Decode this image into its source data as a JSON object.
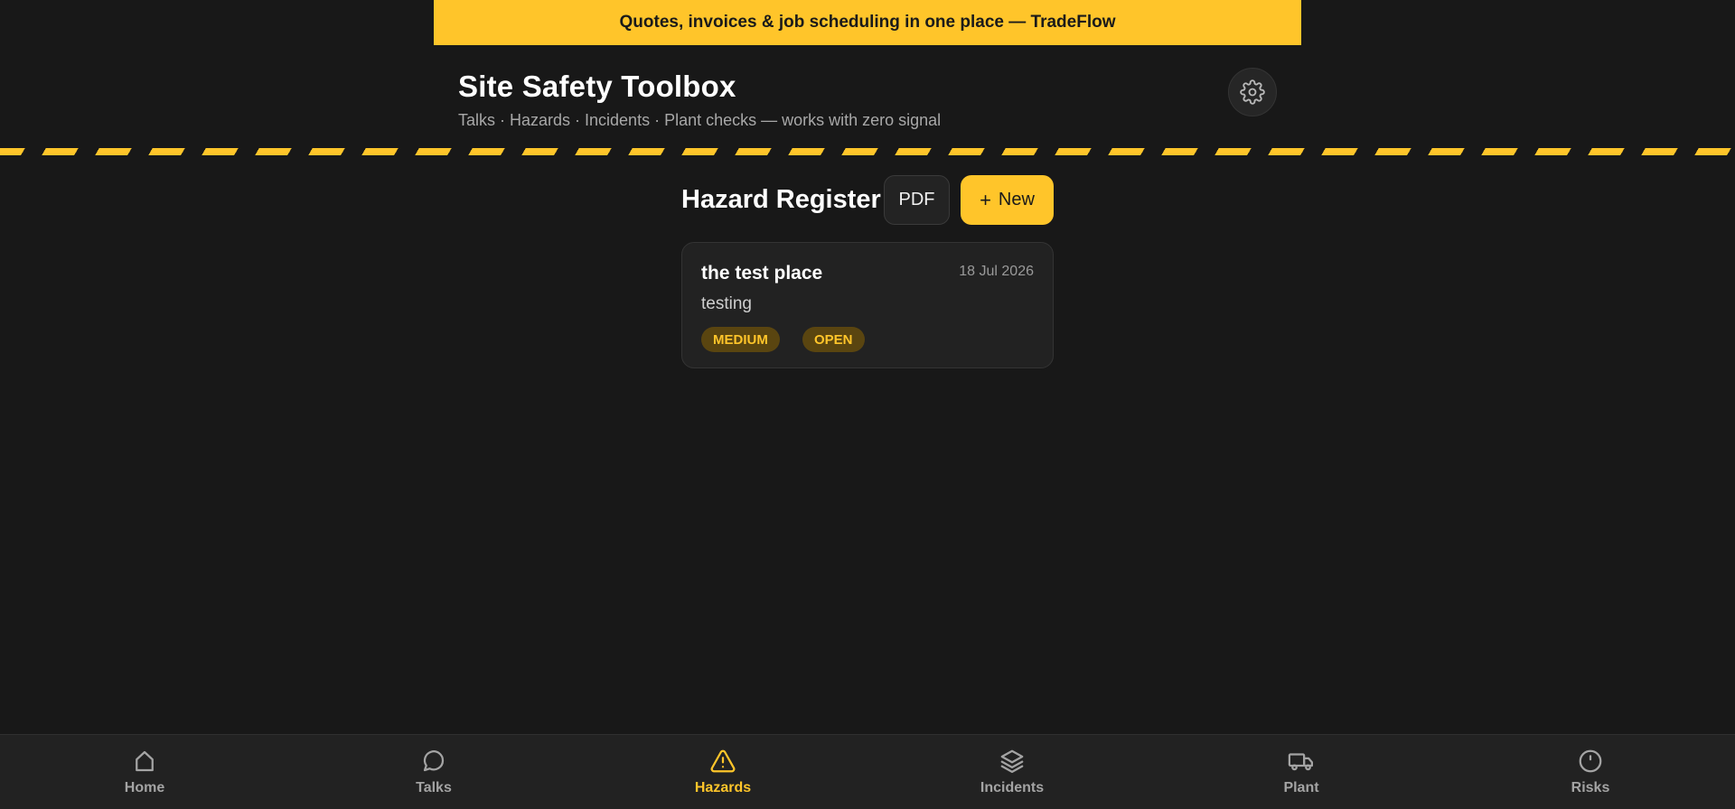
{
  "promo_banner": {
    "text": "Quotes, invoices & job scheduling in one place — TradeFlow"
  },
  "header": {
    "title": "Site Safety Toolbox",
    "subtitle": "Talks · Hazards · Incidents · Plant checks — works with zero signal",
    "settings_icon": "gear-icon"
  },
  "section": {
    "title": "Hazard Register",
    "pdf_label": "PDF",
    "new_plus": "+",
    "new_label": "New"
  },
  "hazards": [
    {
      "location": "the test place",
      "date": "18 Jul 2026",
      "description": "testing",
      "severity": "MEDIUM",
      "status": "OPEN"
    }
  ],
  "nav": {
    "active": "Hazards",
    "items": [
      {
        "label": "Home",
        "icon": "home-icon"
      },
      {
        "label": "Talks",
        "icon": "speech-bubble-icon"
      },
      {
        "label": "Hazards",
        "icon": "warning-triangle-icon"
      },
      {
        "label": "Incidents",
        "icon": "layers-icon"
      },
      {
        "label": "Plant",
        "icon": "truck-icon"
      },
      {
        "label": "Risks",
        "icon": "alert-circle-icon"
      }
    ]
  },
  "colors": {
    "accent": "#ffc52a",
    "background": "#181818",
    "surface": "#222222",
    "badge_bg": "#5a4510"
  }
}
